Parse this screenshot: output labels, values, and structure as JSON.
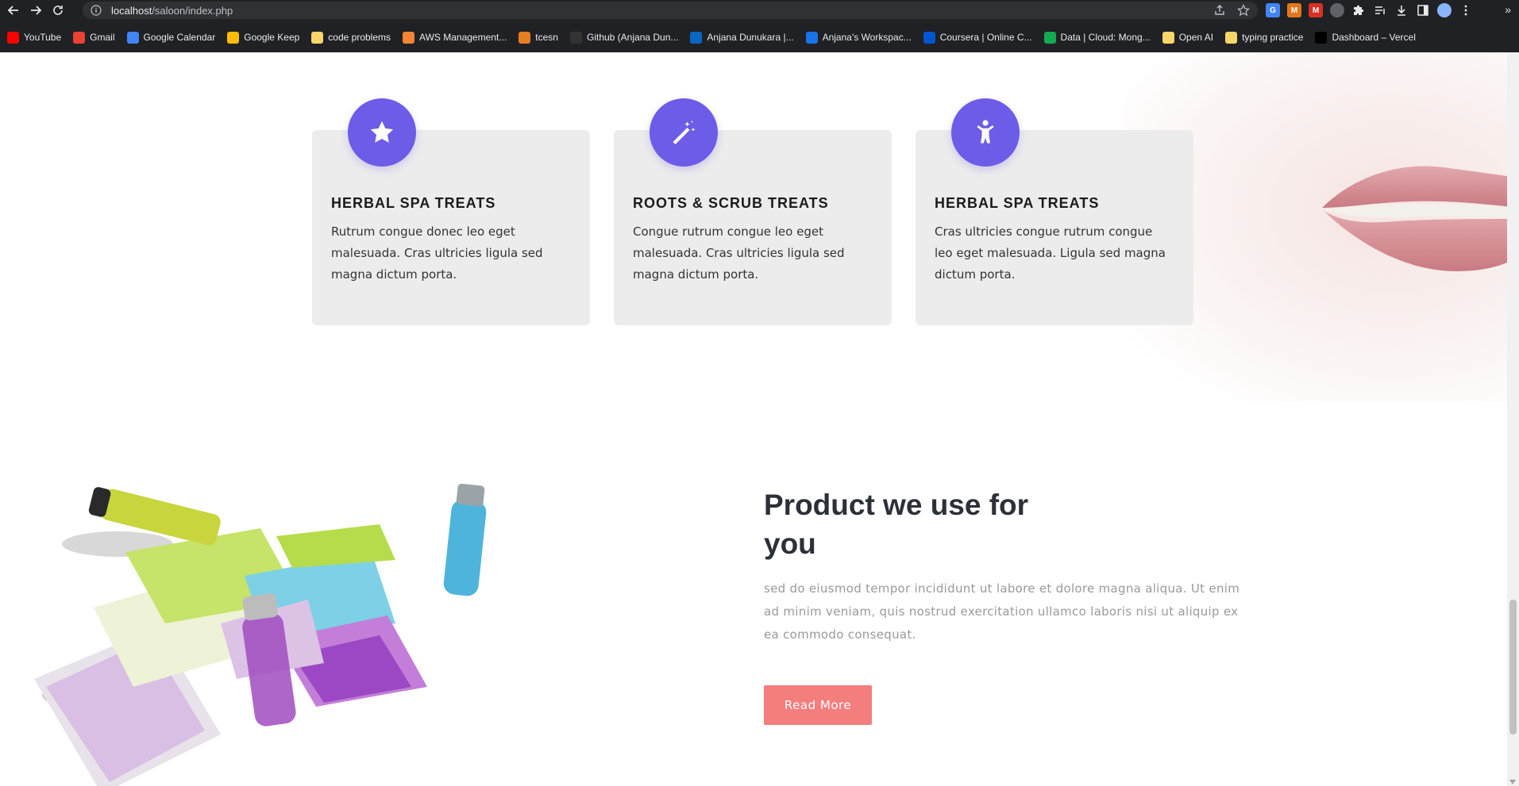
{
  "browser": {
    "url_host": "localhost",
    "url_path": "/saloon/index.php"
  },
  "bookmarks": [
    {
      "label": "YouTube",
      "icon": "youtube-icon",
      "color": "#ff0000"
    },
    {
      "label": "Gmail",
      "icon": "gmail-icon",
      "color": "#ea4335"
    },
    {
      "label": "Google Calendar",
      "icon": "calendar-icon",
      "color": "#4285f4"
    },
    {
      "label": "Google Keep",
      "icon": "keep-icon",
      "color": "#fbbc04"
    },
    {
      "label": "code problems",
      "icon": "folder-icon",
      "color": "#f6d66b"
    },
    {
      "label": "AWS Management...",
      "icon": "aws-icon",
      "color": "#f58536"
    },
    {
      "label": "tcesn",
      "icon": "tcesn-icon",
      "color": "#e67e22"
    },
    {
      "label": "Github (Anjana Dun...",
      "icon": "github-icon",
      "color": "#333333"
    },
    {
      "label": "Anjana Dunukara |...",
      "icon": "linkedin-icon",
      "color": "#0a66c2"
    },
    {
      "label": "Anjana's Workspac...",
      "icon": "workspace-icon",
      "color": "#1a73e8"
    },
    {
      "label": "Coursera | Online C...",
      "icon": "coursera-icon",
      "color": "#0056d2"
    },
    {
      "label": "Data | Cloud: Mong...",
      "icon": "mongodb-icon",
      "color": "#13aa52"
    },
    {
      "label": "Open AI",
      "icon": "folder-icon",
      "color": "#f6d66b"
    },
    {
      "label": "typing practice",
      "icon": "folder-icon",
      "color": "#f6d66b"
    },
    {
      "label": "Dashboard – Vercel",
      "icon": "vercel-icon",
      "color": "#000000"
    }
  ],
  "services": [
    {
      "title": "HERBAL SPA TREATS",
      "text": "Rutrum congue donec leo eget malesuada. Cras ultricies ligula sed magna dictum porta.",
      "icon": "star-icon"
    },
    {
      "title": "ROOTS & SCRUB TREATS",
      "text": "Congue rutrum congue leo eget malesuada. Cras ultricies ligula sed magna dictum porta.",
      "icon": "magic-wand-icon"
    },
    {
      "title": "HERBAL SPA TREATS",
      "text": "Cras ultricies congue rutrum congue leo eget malesuada. Ligula sed magna dictum porta.",
      "icon": "child-icon"
    }
  ],
  "product": {
    "title": "Product we use for you",
    "text": "sed do eiusmod tempor incididunt ut labore et dolore magna aliqua. Ut enim ad minim veniam, quis nostrud exercitation ullamco laboris nisi ut aliquip ex ea commodo consequat.",
    "button": "Read More"
  },
  "colors": {
    "accent": "#6c5ce7",
    "button": "#f47d7d",
    "card_bg": "#ececec"
  }
}
